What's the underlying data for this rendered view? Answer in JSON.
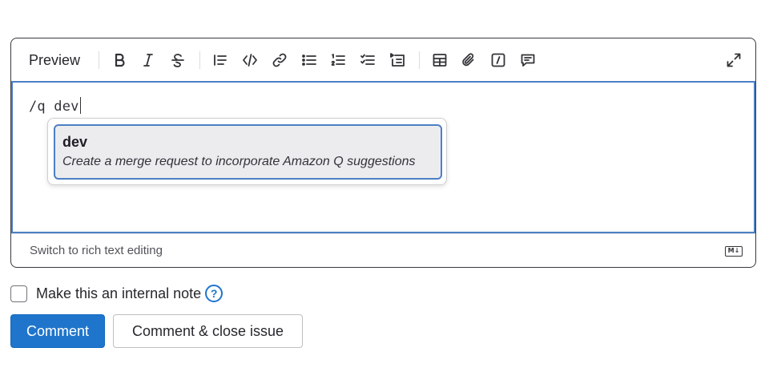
{
  "toolbar": {
    "preview_label": "Preview",
    "buttons": [
      {
        "icon": "bold-icon",
        "label": "Bold"
      },
      {
        "icon": "italic-icon",
        "label": "Italic"
      },
      {
        "icon": "strikethrough-icon",
        "label": "Strikethrough"
      },
      {
        "icon": "quote-icon",
        "label": "Quote"
      },
      {
        "icon": "code-icon",
        "label": "Code"
      },
      {
        "icon": "link-icon",
        "label": "Link"
      },
      {
        "icon": "bullet-list-icon",
        "label": "Bullet list"
      },
      {
        "icon": "numbered-list-icon",
        "label": "Numbered list"
      },
      {
        "icon": "task-list-icon",
        "label": "Task list"
      },
      {
        "icon": "collapsible-section-icon",
        "label": "Collapsible section"
      },
      {
        "icon": "table-icon",
        "label": "Table"
      },
      {
        "icon": "attach-file-icon",
        "label": "Attach file"
      },
      {
        "icon": "quick-actions-icon",
        "label": "Quick actions"
      },
      {
        "icon": "comment-template-icon",
        "label": "Comment templates"
      },
      {
        "icon": "fullscreen-icon",
        "label": "Fullscreen"
      }
    ]
  },
  "editor": {
    "value": "/q dev"
  },
  "autocomplete": {
    "items": [
      {
        "title": "dev",
        "description": "Create a merge request to incorporate Amazon Q suggestions"
      }
    ]
  },
  "footer": {
    "switch_label": "Switch to rich text editing",
    "markdown_badge": "M↓"
  },
  "internal_note": {
    "label": "Make this an internal note",
    "help_glyph": "?"
  },
  "actions": {
    "comment_label": "Comment",
    "comment_close_label": "Comment & close issue"
  },
  "colors": {
    "primary": "#1f75cb",
    "focus_border": "#4b80c3"
  }
}
